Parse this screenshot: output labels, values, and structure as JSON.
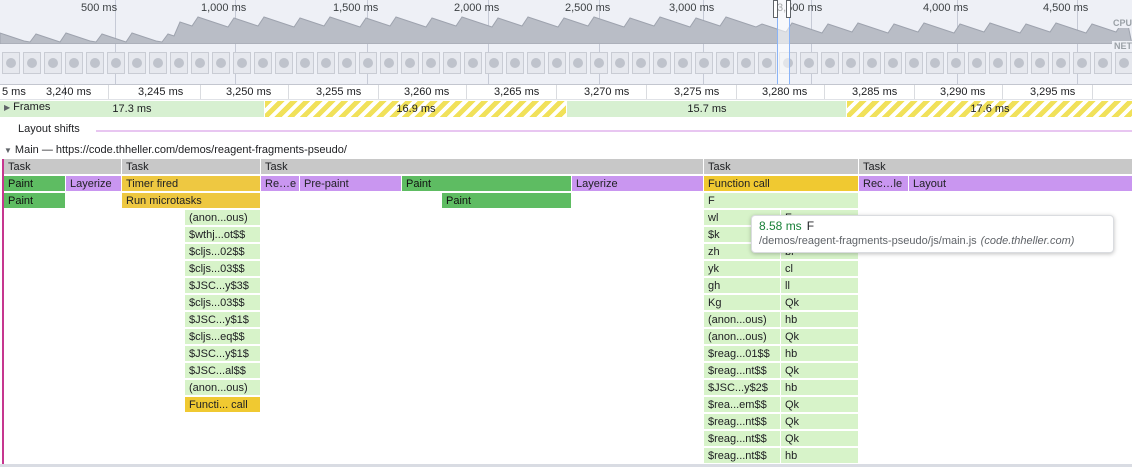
{
  "overview": {
    "labels": [
      "500 ms",
      "1,000 ms",
      "1,500 ms",
      "2,000 ms",
      "2,500 ms",
      "3,000 ms",
      "3,500 ms",
      "4,000 ms",
      "4,500 ms"
    ],
    "cpu_tag": "CPU",
    "net_tag": "NET"
  },
  "ruler": {
    "labels": [
      "5 ms",
      "3,240 ms",
      "3,245 ms",
      "3,250 ms",
      "3,255 ms",
      "3,260 ms",
      "3,265 ms",
      "3,270 ms",
      "3,275 ms",
      "3,280 ms",
      "3,285 ms",
      "3,290 ms",
      "3,295 ms"
    ]
  },
  "tracks": {
    "frames_label": "Frames",
    "frames": [
      "17.3 ms",
      "16.9 ms",
      "15.7 ms",
      "17.6 ms"
    ],
    "layout_label": "Layout shifts",
    "main_label": "Main — https://code.thheller.com/demos/reagent-fragments-pseudo/"
  },
  "flame": {
    "row0": [
      "Task",
      "Task",
      "Task",
      "Task",
      "Task"
    ],
    "row1": [
      "Paint",
      "Layerize",
      "Timer fired",
      "Re…e",
      "Pre-paint",
      "Paint",
      "Layerize",
      "Function call",
      "Rec…le",
      "Layout"
    ],
    "row2": [
      "Paint",
      "Run microtasks",
      "Paint",
      "F"
    ],
    "stack_a": [
      "(anon...ous)",
      "$wthj...ot$$",
      "$cljs...02$$",
      "$cljs...03$$",
      "$JSC...y$3$",
      "$cljs...03$$",
      "$JSC...y$1$",
      "$cljs...eq$$",
      "$JSC...y$1$",
      "$JSC...al$$",
      "(anon...ous)",
      "Functi... call"
    ],
    "stack_b": [
      "wl",
      "$k",
      "zh",
      "yk",
      "gh",
      "Kg",
      "(anon...ous)",
      "(anon...ous)",
      "$reag...01$$",
      "$reag...nt$$",
      "$JSC...y$2$",
      "$rea...em$$",
      "$reag...nt$$",
      "$reag...nt$$",
      "$reag...nt$$"
    ],
    "stack_c": [
      "F",
      "",
      "bl",
      "cl",
      "ll",
      "Qk",
      "hb",
      "Qk",
      "hb",
      "Qk",
      "hb",
      "Qk",
      "Qk",
      "Qk",
      "hb"
    ]
  },
  "tooltip": {
    "duration": "8.58 ms",
    "name": "F",
    "path": "/demos/reagent-fragments-pseudo/js/main.js",
    "domain": "(code.thheller.com)"
  }
}
